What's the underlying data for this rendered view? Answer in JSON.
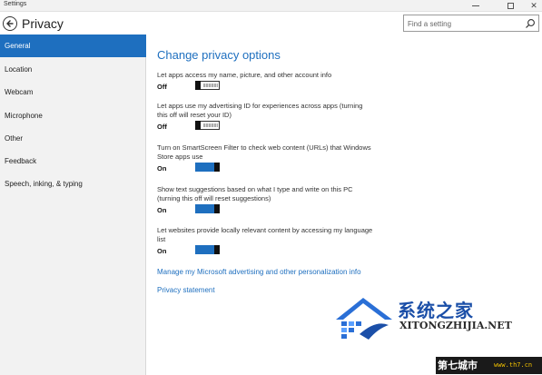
{
  "window": {
    "title": "Settings"
  },
  "header": {
    "title": "Privacy",
    "search_placeholder": "Find a setting"
  },
  "sidebar": {
    "items": [
      {
        "label": "General",
        "active": true
      },
      {
        "label": "Location",
        "active": false
      },
      {
        "label": "Webcam",
        "active": false
      },
      {
        "label": "Microphone",
        "active": false
      },
      {
        "label": "Other",
        "active": false
      },
      {
        "label": "Feedback",
        "active": false
      },
      {
        "label": "Speech, inking, & typing",
        "active": false
      }
    ]
  },
  "main": {
    "title": "Change privacy options",
    "settings": [
      {
        "description": "Let apps access my name, picture, and other account info",
        "state": "Off"
      },
      {
        "description": "Let apps use my advertising ID for experiences across apps (turning this off will reset your ID)",
        "state": "Off"
      },
      {
        "description": "Turn on SmartScreen Filter to check web content (URLs) that Windows Store apps use",
        "state": "On"
      },
      {
        "description": "Show text suggestions based on what I type and write on this PC (turning this off will reset suggestions)",
        "state": "On"
      },
      {
        "description": "Let websites provide locally relevant content by accessing my language list",
        "state": "On"
      }
    ],
    "links": {
      "advertising": "Manage my Microsoft advertising and other personalization info",
      "statement": "Privacy statement"
    }
  },
  "watermark": {
    "chinese": "系统之家",
    "english": "XITONGZHIJIA.NET",
    "badge": "第七城市",
    "site": "www.th7.cn"
  },
  "colors": {
    "accent": "#1e6fbf",
    "sidebar_bg": "#f2f2f2"
  }
}
